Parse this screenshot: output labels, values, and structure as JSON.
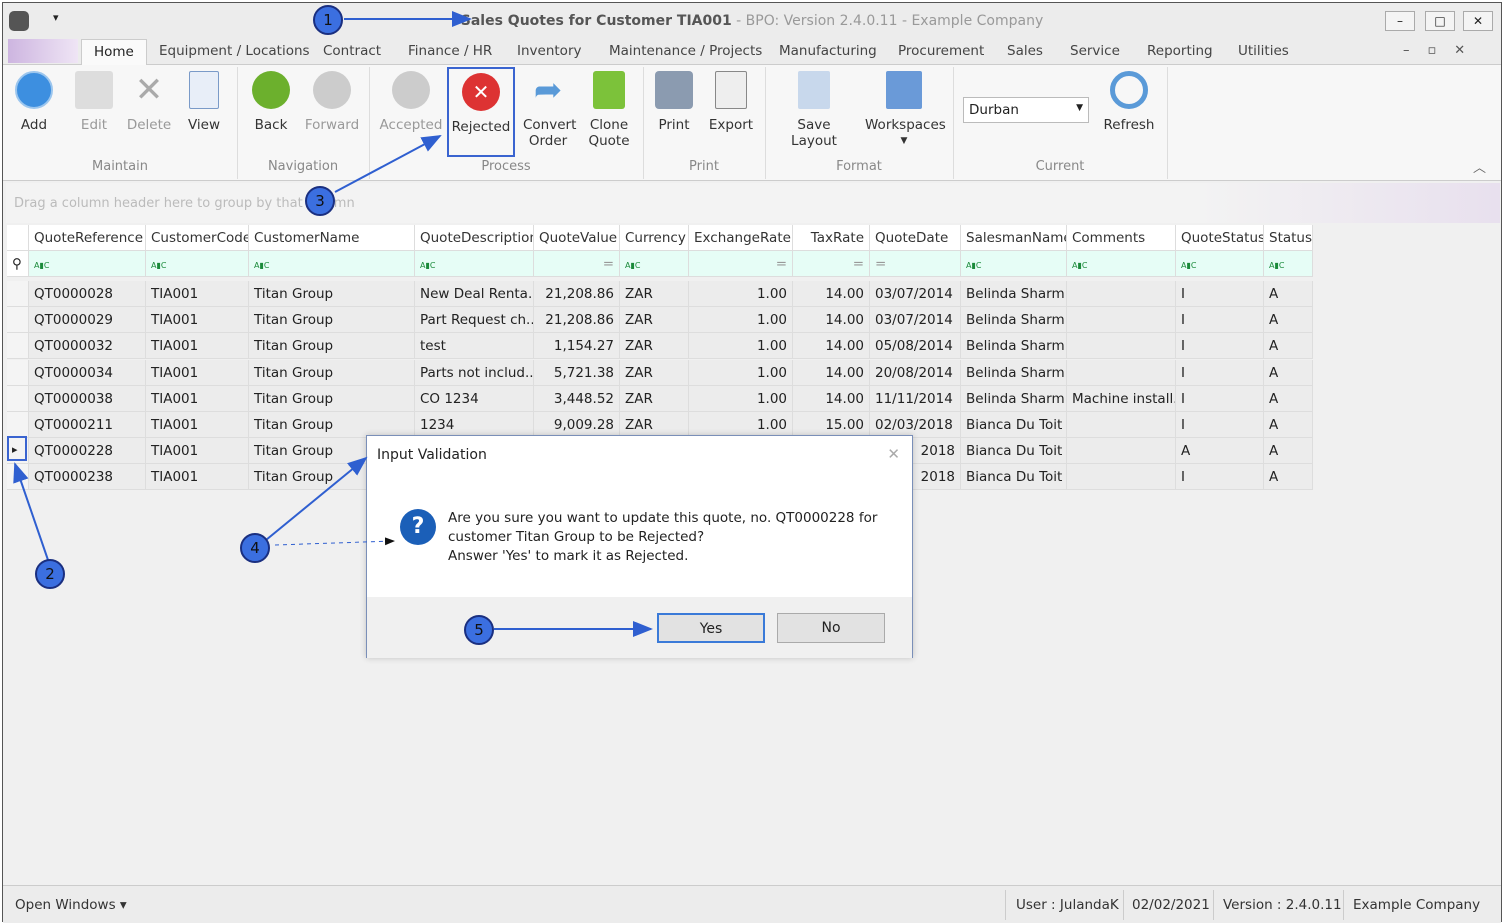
{
  "window": {
    "title_main": "Sales Quotes for Customer TIA001",
    "title_rest": " - BPO: Version 2.4.0.11 - Example Company"
  },
  "tabs": [
    "Home",
    "Equipment / Locations",
    "Contract",
    "Finance / HR",
    "Inventory",
    "Maintenance / Projects",
    "Manufacturing",
    "Procurement",
    "Sales",
    "Service",
    "Reporting",
    "Utilities"
  ],
  "ribbon": {
    "buttons": [
      {
        "label": "Add",
        "icon": "add-icon",
        "enabled": true
      },
      {
        "label": "Edit",
        "icon": "edit-icon",
        "enabled": false
      },
      {
        "label": "Delete",
        "icon": "delete-icon",
        "enabled": false
      },
      {
        "label": "View",
        "icon": "view-icon",
        "enabled": true
      },
      {
        "label": "Back",
        "icon": "back-icon",
        "enabled": true
      },
      {
        "label": "Forward",
        "icon": "forward-icon",
        "enabled": false
      },
      {
        "label": "Accepted",
        "icon": "accepted-icon",
        "enabled": false
      },
      {
        "label": "Rejected",
        "icon": "rejected-icon",
        "enabled": true
      },
      {
        "label": "Convert Order",
        "icon": "convert-icon",
        "enabled": true
      },
      {
        "label": "Clone Quote",
        "icon": "clone-icon",
        "enabled": true
      },
      {
        "label": "Print",
        "icon": "print-icon",
        "enabled": true
      },
      {
        "label": "Export",
        "icon": "export-icon",
        "enabled": true
      },
      {
        "label": "Save Layout",
        "icon": "save-layout-icon",
        "enabled": true
      },
      {
        "label": "Workspaces",
        "icon": "workspaces-icon",
        "enabled": true
      },
      {
        "label": "Refresh",
        "icon": "refresh-icon",
        "enabled": true
      }
    ],
    "groups": [
      "Maintain",
      "Navigation",
      "Process",
      "Print",
      "Format",
      "Current"
    ],
    "branch": "Durban"
  },
  "grid": {
    "group_hint": "Drag a column header here to group by that column",
    "columns": [
      "QuoteReference",
      "CustomerCode",
      "CustomerName",
      "QuoteDescription",
      "QuoteValue",
      "Currency",
      "ExchangeRate",
      "TaxRate",
      "QuoteDate",
      "SalesmanName",
      "Comments",
      "QuoteStatus",
      "Status"
    ],
    "rows": [
      [
        "QT0000028",
        "TIA001",
        "Titan Group",
        "New Deal Renta...",
        "21,208.86",
        "ZAR",
        "1.00",
        "14.00",
        "03/07/2014",
        "Belinda Sharm...",
        "",
        "I",
        "A"
      ],
      [
        "QT0000029",
        "TIA001",
        "Titan Group",
        "Part Request ch...",
        "21,208.86",
        "ZAR",
        "1.00",
        "14.00",
        "03/07/2014",
        "Belinda Sharm...",
        "",
        "I",
        "A"
      ],
      [
        "QT0000032",
        "TIA001",
        "Titan Group",
        "test",
        "1,154.27",
        "ZAR",
        "1.00",
        "14.00",
        "05/08/2014",
        "Belinda Sharm...",
        "",
        "I",
        "A"
      ],
      [
        "QT0000034",
        "TIA001",
        "Titan Group",
        "Parts not includ...",
        "5,721.38",
        "ZAR",
        "1.00",
        "14.00",
        "20/08/2014",
        "Belinda Sharm...",
        "",
        "I",
        "A"
      ],
      [
        "QT0000038",
        "TIA001",
        "Titan Group",
        "CO 1234",
        "3,448.52",
        "ZAR",
        "1.00",
        "14.00",
        "11/11/2014",
        "Belinda Sharm...",
        "Machine install...",
        "I",
        "A"
      ],
      [
        "QT0000211",
        "TIA001",
        "Titan Group",
        "1234",
        "9,009.28",
        "ZAR",
        "1.00",
        "15.00",
        "02/03/2018",
        "Bianca Du Toit",
        "",
        "I",
        "A"
      ],
      [
        "QT0000228",
        "TIA001",
        "Titan Group",
        "",
        "",
        "",
        "",
        "",
        "2018",
        "Bianca Du Toit",
        "",
        "A",
        "A"
      ],
      [
        "QT0000238",
        "TIA001",
        "Titan Group",
        "",
        "",
        "",
        "",
        "",
        "2018",
        "Bianca Du Toit",
        "",
        "I",
        "A"
      ]
    ]
  },
  "dialog": {
    "title": "Input Validation",
    "line1": "Are you sure you want to update this quote, no. QT0000228 for",
    "line2": "customer Titan Group to be Rejected?",
    "line3": "Answer 'Yes' to mark it as Rejected.",
    "yes": "Yes",
    "no": "No"
  },
  "statusbar": {
    "open_windows": "Open Windows ▾",
    "user": "User : JulandaK",
    "date": "02/02/2021",
    "version": "Version : 2.4.0.11",
    "company": "Example Company"
  },
  "annotations": [
    "1",
    "2",
    "3",
    "4",
    "5"
  ]
}
